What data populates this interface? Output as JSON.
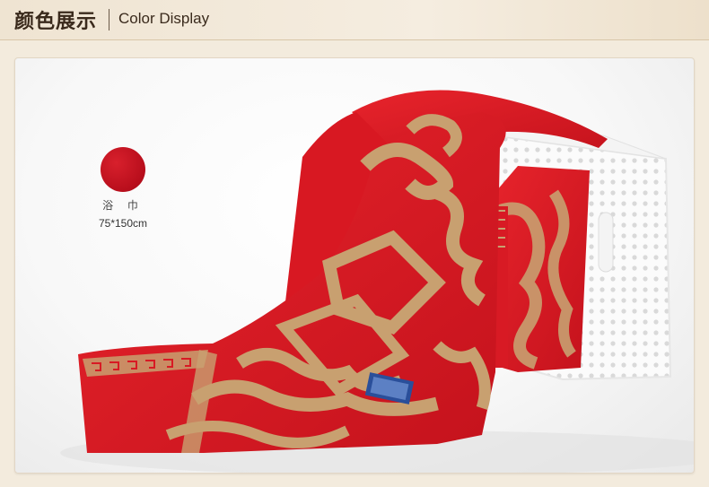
{
  "header": {
    "title_cn": "颜色展示",
    "title_en": "Color Display"
  },
  "swatch": {
    "color": "#c8101e",
    "name": "浴 巾",
    "size": "75*150cm"
  },
  "colors": {
    "towel_red": "#e4202a",
    "pattern_gold": "#c8a070",
    "basket": "#ffffff",
    "background": "#f3ebdd"
  }
}
